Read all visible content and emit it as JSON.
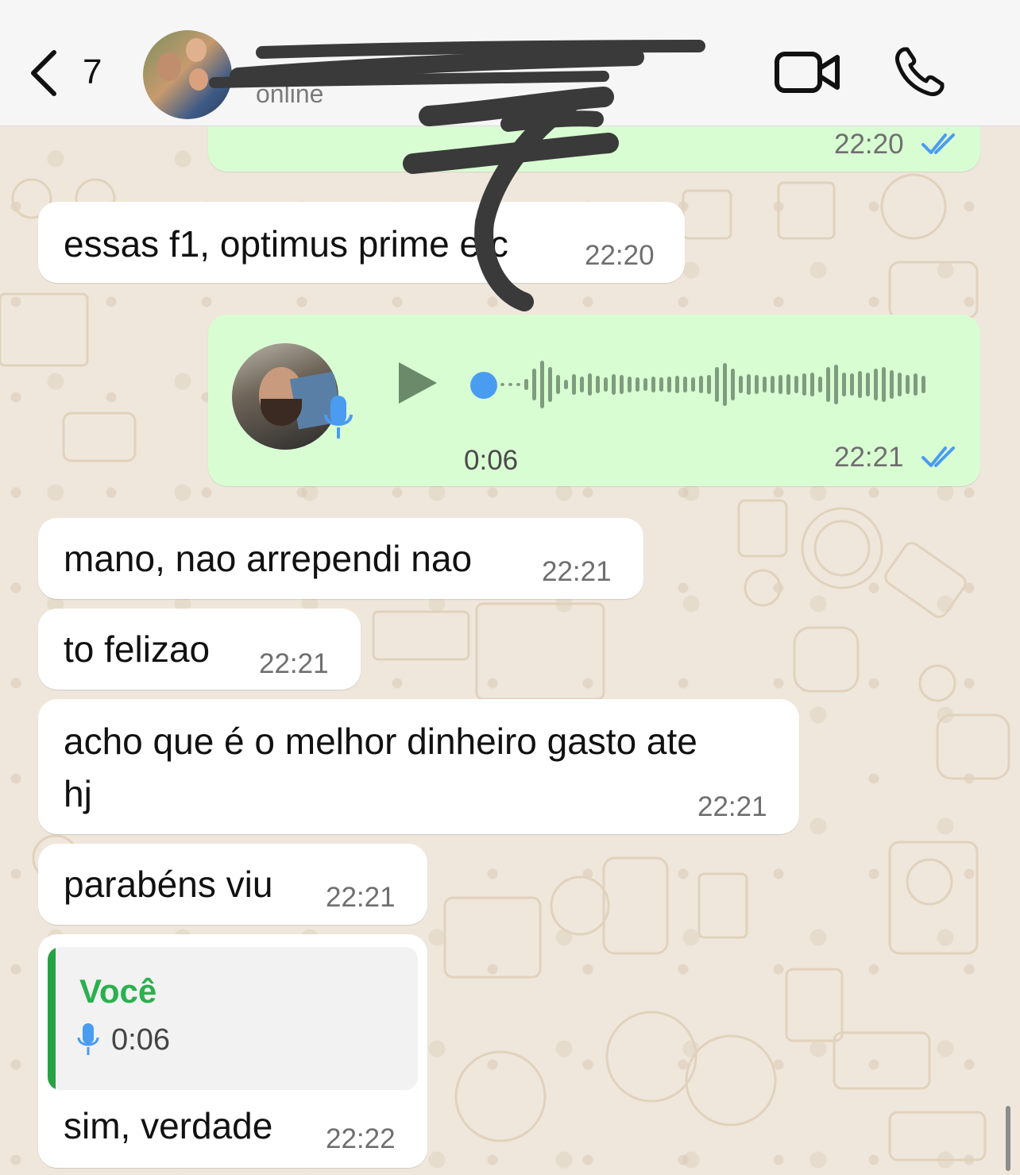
{
  "header": {
    "back_count": "7",
    "contact_name": "",
    "status": "online"
  },
  "messages": {
    "m0": {
      "time": "22:20",
      "status": "read"
    },
    "m1": {
      "text": "essas f1, optimus prime etc",
      "time": "22:20"
    },
    "m2": {
      "type": "voice",
      "duration": "0:06",
      "time": "22:21",
      "status": "read",
      "played_fraction": 0.0
    },
    "m3": {
      "text": "mano, nao arrependi nao",
      "time": "22:21"
    },
    "m4": {
      "text": "to felizao",
      "time": "22:21"
    },
    "m5": {
      "line1": "acho que é o melhor dinheiro gasto ate",
      "line2": "hj",
      "time": "22:21"
    },
    "m6": {
      "text": "parabéns viu",
      "time": "22:21"
    },
    "m7": {
      "quote": {
        "author": "Você",
        "duration": "0:06"
      },
      "text": "sim, verdade",
      "time": "22:22"
    }
  },
  "icons": {
    "back": "chevron-left-icon",
    "video": "video-camera-icon",
    "call": "phone-icon",
    "read_receipt": "double-check-icon",
    "play": "play-icon",
    "mic": "microphone-icon"
  },
  "colors": {
    "accent_blue": "#4a9cf0",
    "outgoing_bubble": "#d9fdd3",
    "incoming_bubble": "#ffffff",
    "quote_green": "#2bb04f",
    "chat_background": "#efe7db"
  }
}
